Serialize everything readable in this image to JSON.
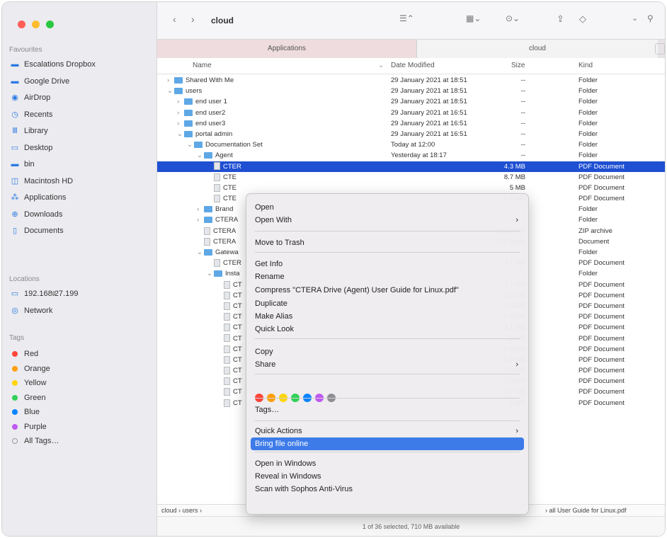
{
  "sidebar": {
    "favourites_label": "Favourites",
    "favourites": [
      {
        "label": "Escalations Dropbox",
        "icon": "folder-icon"
      },
      {
        "label": "Google Drive",
        "icon": "folder-icon"
      },
      {
        "label": "AirDrop",
        "icon": "airdrop-icon"
      },
      {
        "label": "Recents",
        "icon": "clock-icon"
      },
      {
        "label": "Library",
        "icon": "library-icon"
      },
      {
        "label": "Desktop",
        "icon": "desktop-icon"
      },
      {
        "label": "bin",
        "icon": "folder-icon"
      },
      {
        "label": "Macintosh HD",
        "icon": "disk-icon"
      },
      {
        "label": "Applications",
        "icon": "applications-icon"
      },
      {
        "label": "Downloads",
        "icon": "downloads-icon"
      },
      {
        "label": "Documents",
        "icon": "document-icon"
      }
    ],
    "locations_label": "Locations",
    "locations": [
      {
        "label": "192.168.27.199",
        "icon": "display-icon"
      },
      {
        "label": "Network",
        "icon": "network-icon"
      }
    ],
    "tags_label": "Tags",
    "tags": [
      {
        "label": "Red",
        "color": "#ff453a"
      },
      {
        "label": "Orange",
        "color": "#ff9f0a"
      },
      {
        "label": "Yellow",
        "color": "#ffd60a"
      },
      {
        "label": "Green",
        "color": "#30d158"
      },
      {
        "label": "Blue",
        "color": "#0a84ff"
      },
      {
        "label": "Purple",
        "color": "#bf5af2"
      },
      {
        "label": "All Tags…",
        "color": ""
      }
    ]
  },
  "toolbar": {
    "title": "cloud",
    "back": "‹",
    "forward": "›"
  },
  "tabs": [
    "Applications",
    "cloud"
  ],
  "columns": {
    "name": "Name",
    "date": "Date Modified",
    "size": "Size",
    "kind": "Kind"
  },
  "rows": [
    {
      "indent": 0,
      "chev": "›",
      "type": "folder",
      "name": "Shared With Me",
      "date": "29 January 2021 at 18:51",
      "size": "--",
      "kind": "Folder"
    },
    {
      "indent": 0,
      "chev": "⌄",
      "type": "folder",
      "name": "users",
      "date": "29 January 2021 at 18:51",
      "size": "--",
      "kind": "Folder"
    },
    {
      "indent": 1,
      "chev": "›",
      "type": "folder",
      "name": "end user 1",
      "date": "29 January 2021 at 18:51",
      "size": "--",
      "kind": "Folder"
    },
    {
      "indent": 1,
      "chev": "›",
      "type": "folder",
      "name": "end user2",
      "date": "29 January 2021 at 16:51",
      "size": "--",
      "kind": "Folder"
    },
    {
      "indent": 1,
      "chev": "›",
      "type": "folder",
      "name": "end user3",
      "date": "29 January 2021 at 16:51",
      "size": "--",
      "kind": "Folder"
    },
    {
      "indent": 1,
      "chev": "⌄",
      "type": "folder",
      "name": "portal admin",
      "date": "29 January 2021 at 16:51",
      "size": "--",
      "kind": "Folder"
    },
    {
      "indent": 2,
      "chev": "⌄",
      "type": "folder",
      "name": "Documentation Set",
      "date": "Today at 12:00",
      "size": "--",
      "kind": "Folder"
    },
    {
      "indent": 3,
      "chev": "⌄",
      "type": "folder",
      "name": "Agent",
      "date": "Yesterday at 18:17",
      "size": "--",
      "kind": "Folder"
    },
    {
      "indent": 4,
      "chev": "",
      "type": "doc",
      "name": "CTER",
      "date": "",
      "size": "4.3 MB",
      "kind": "PDF Document",
      "selected": true
    },
    {
      "indent": 4,
      "chev": "",
      "type": "doc",
      "name": "CTE",
      "date": "",
      "size": "8.7 MB",
      "kind": "PDF Document"
    },
    {
      "indent": 4,
      "chev": "",
      "type": "doc",
      "name": "CTE",
      "date": "",
      "size": "5 MB",
      "kind": "PDF Document"
    },
    {
      "indent": 4,
      "chev": "",
      "type": "doc",
      "name": "CTE",
      "date": "",
      "size": "5.5 MB",
      "kind": "PDF Document"
    },
    {
      "indent": 3,
      "chev": "›",
      "type": "folder",
      "name": "Brand",
      "date": "",
      "size": "--",
      "kind": "Folder"
    },
    {
      "indent": 3,
      "chev": "›",
      "type": "folder",
      "name": "CTERA",
      "date": "",
      "size": "--",
      "kind": "Folder"
    },
    {
      "indent": 3,
      "chev": "",
      "type": "doc",
      "name": "CTERA",
      "date": "",
      "size": "106.7 MB",
      "kind": "ZIP archive"
    },
    {
      "indent": 3,
      "chev": "",
      "type": "doc",
      "name": "CTERA",
      "date": "",
      "size": "538 bytes",
      "kind": "Document"
    },
    {
      "indent": 3,
      "chev": "⌄",
      "type": "folder",
      "name": "Gatewa",
      "date": "",
      "size": "--",
      "kind": "Folder"
    },
    {
      "indent": 4,
      "chev": "",
      "type": "doc",
      "name": "CTER",
      "date": "",
      "size": "7.7 MB",
      "kind": "PDF Document"
    },
    {
      "indent": 4,
      "chev": "⌄",
      "type": "folder",
      "name": "Insta",
      "date": "",
      "size": "--",
      "kind": "Folder"
    },
    {
      "indent": 5,
      "chev": "",
      "type": "doc",
      "name": "CT",
      "date": "",
      "size": "1.7 MB",
      "kind": "PDF Document"
    },
    {
      "indent": 5,
      "chev": "",
      "type": "doc",
      "name": "CT",
      "date": "",
      "size": "2.5 MB",
      "kind": "PDF Document"
    },
    {
      "indent": 5,
      "chev": "",
      "type": "doc",
      "name": "CT",
      "date": "",
      "size": "1.6 MB",
      "kind": "PDF Document"
    },
    {
      "indent": 5,
      "chev": "",
      "type": "doc",
      "name": "CT",
      "date": "",
      "size": "1.9 MB",
      "kind": "PDF Document"
    },
    {
      "indent": 5,
      "chev": "",
      "type": "doc",
      "name": "CT",
      "date": "",
      "size": "2.1 MB",
      "kind": "PDF Document"
    },
    {
      "indent": 5,
      "chev": "",
      "type": "doc",
      "name": "CT",
      "date": "",
      "size": "2 MB",
      "kind": "PDF Document"
    },
    {
      "indent": 5,
      "chev": "",
      "type": "doc",
      "name": "CT",
      "date": "",
      "size": "6.5 MB",
      "kind": "PDF Document"
    },
    {
      "indent": 5,
      "chev": "",
      "type": "doc",
      "name": "CT",
      "date": "",
      "size": "6.3 MB",
      "kind": "PDF Document"
    },
    {
      "indent": 5,
      "chev": "",
      "type": "doc",
      "name": "CT",
      "date": "",
      "size": "2.3 MB",
      "kind": "PDF Document"
    },
    {
      "indent": 5,
      "chev": "",
      "type": "doc",
      "name": "CT",
      "date": "",
      "size": "7.3 MB",
      "kind": "PDF Document"
    },
    {
      "indent": 5,
      "chev": "",
      "type": "doc",
      "name": "CT",
      "date": "",
      "size": "2.7 MB",
      "kind": "PDF Document"
    },
    {
      "indent": 5,
      "chev": "",
      "type": "doc",
      "name": "CT",
      "date": "",
      "size": "2 MB",
      "kind": "PDF Document"
    }
  ],
  "pathbar": {
    "start": "cloud › users ›",
    "end": "› all User Guide for Linux.pdf"
  },
  "status": "1 of 36 selected, 710 MB available",
  "context_menu": {
    "items": [
      {
        "label": "Open",
        "sub": false
      },
      {
        "label": "Open With",
        "sub": true
      },
      {
        "label": "Move to Trash",
        "sub": false
      },
      {
        "label": "Get Info",
        "sub": false
      },
      {
        "label": "Rename",
        "sub": false
      },
      {
        "label": "Compress \"CTERA Drive (Agent) User Guide for Linux.pdf\"",
        "sub": false
      },
      {
        "label": "Duplicate",
        "sub": false
      },
      {
        "label": "Make Alias",
        "sub": false
      },
      {
        "label": "Quick Look",
        "sub": false
      },
      {
        "label": "Copy",
        "sub": false
      },
      {
        "label": "Share",
        "sub": true
      },
      {
        "label": "Tags…",
        "sub": false
      },
      {
        "label": "Quick Actions",
        "sub": true
      },
      {
        "label": "Bring file online",
        "sub": false,
        "highlighted": true
      },
      {
        "label": "Open in Windows",
        "sub": false
      },
      {
        "label": "Reveal in Windows",
        "sub": false
      },
      {
        "label": "Scan with Sophos Anti-Virus",
        "sub": false
      }
    ],
    "tag_colors": [
      "#ff453a",
      "#ff9f0a",
      "#ffd60a",
      "#30d158",
      "#0a84ff",
      "#bf5af2",
      "#8e8e93"
    ]
  }
}
